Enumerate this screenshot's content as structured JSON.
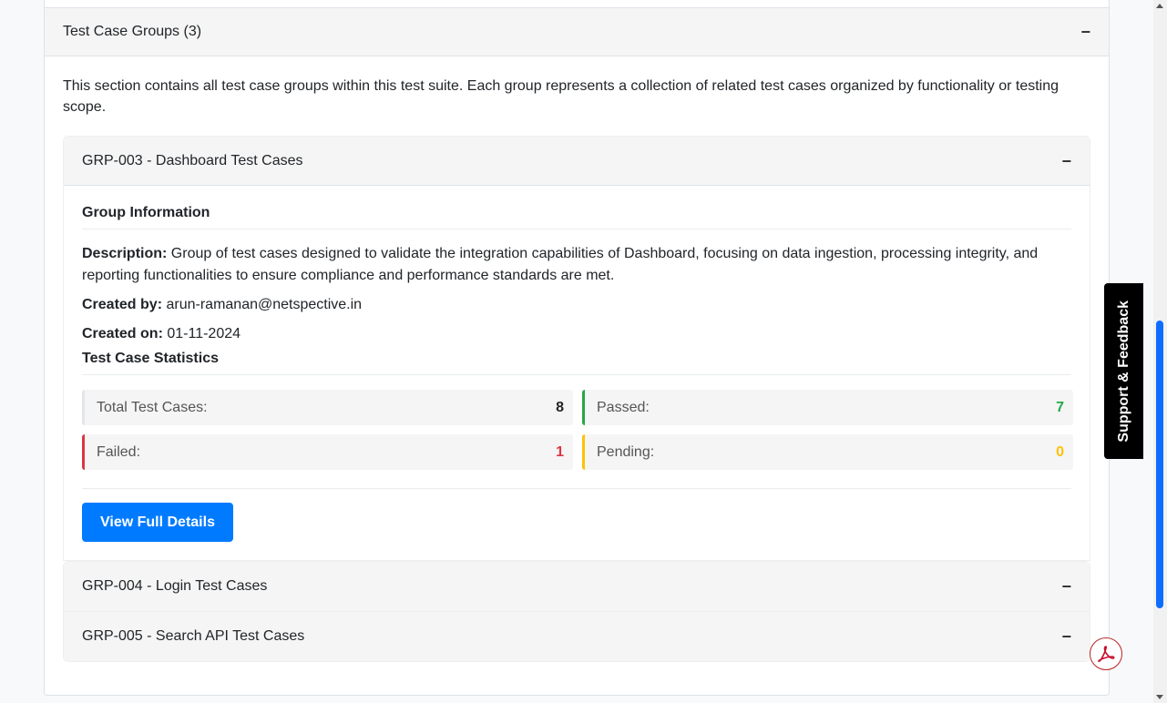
{
  "outer": {
    "title": "Test Case Groups (3)",
    "toggle": "−",
    "intro": "This section contains all test case groups within this test suite. Each group represents a collection of related test cases organized by functionality or testing scope."
  },
  "groups": [
    {
      "title": "GRP-003 - Dashboard Test Cases",
      "toggle": "−",
      "info_title": "Group Information",
      "description_label": "Description:",
      "description": "Group of test cases designed to validate the integration capabilities of Dashboard, focusing on data ingestion, processing integrity, and reporting functionalities to ensure compliance and performance standards are met.",
      "created_by_label": "Created by:",
      "created_by": "arun-ramanan@netspective.in",
      "created_on_label": "Created on:",
      "created_on": "01-11-2024",
      "stats_title": "Test Case Statistics",
      "stats": {
        "total_label": "Total Test Cases:",
        "total": "8",
        "passed_label": "Passed:",
        "passed": "7",
        "failed_label": "Failed:",
        "failed": "1",
        "pending_label": "Pending:",
        "pending": "0"
      },
      "button_label": "View Full Details"
    },
    {
      "title": "GRP-004 - Login Test Cases",
      "toggle": "−"
    },
    {
      "title": "GRP-005 - Search API Test Cases",
      "toggle": "−"
    }
  ],
  "support_tab": "Support & Feedback",
  "pdf_icon": "acrobat-pdf-icon",
  "colors": {
    "primary": "#007bff",
    "passed": "#28a745",
    "failed": "#dc3545",
    "pending": "#ffc107"
  }
}
